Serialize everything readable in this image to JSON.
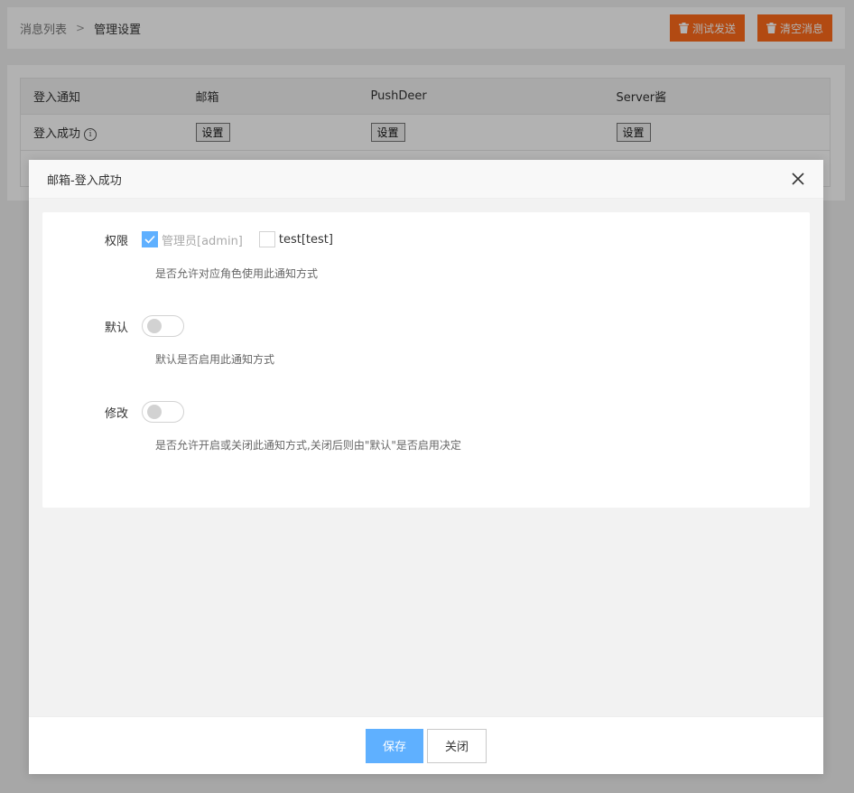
{
  "breadcrumb": {
    "parent": "消息列表",
    "separator": ">",
    "current": "管理设置"
  },
  "top_actions": {
    "test_send": "测试发送",
    "clear_messages": "清空消息"
  },
  "table": {
    "headers": [
      "登入通知",
      "邮箱",
      "PushDeer",
      "Server酱"
    ],
    "rows": [
      {
        "name": "登入成功",
        "set_label": "设置"
      }
    ]
  },
  "modal": {
    "title": "邮箱-登入成功",
    "permission": {
      "label": "权限",
      "options": [
        {
          "text": "管理员[admin]",
          "checked": true,
          "disabled": true
        },
        {
          "text": "test[test]",
          "checked": false,
          "disabled": false
        }
      ],
      "hint": "是否允许对应角色使用此通知方式"
    },
    "default": {
      "label": "默认",
      "on": false,
      "hint": "默认是否启用此通知方式"
    },
    "modify": {
      "label": "修改",
      "on": false,
      "hint": "是否允许开启或关闭此通知方式,关闭后则由\"默认\"是否启用决定"
    },
    "save": "保存",
    "close": "关闭"
  },
  "colors": {
    "accent_orange": "#ff6a1a",
    "primary_blue": "#5fb0ff"
  }
}
